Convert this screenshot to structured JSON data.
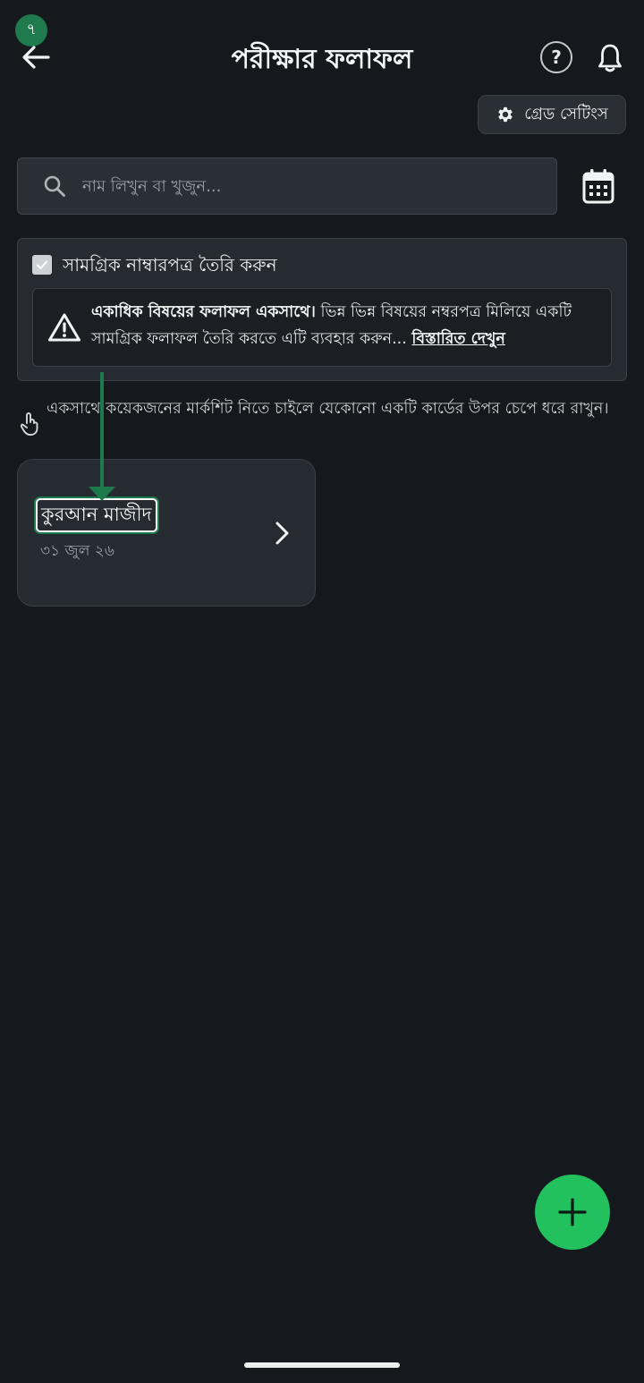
{
  "step_badge": "৭",
  "header": {
    "title": "পরীক্ষার ফলাফল",
    "help_label": "?",
    "grade_settings_label": "গ্রেড সেটিংস"
  },
  "search": {
    "placeholder": "নাম লিখুন বা খুজুন..."
  },
  "combined_marksheet": {
    "checkbox_label": "সামগ্রিক নাম্বারপত্র তৈরি করুন",
    "checked": true,
    "notice_bold": "একাধিক বিষয়ের ফলাফল একসাথে।",
    "notice_text": " ভিন্ন ভিন্ন বিষয়ের নম্বরপত্র মিলিয়ে একটি সামগ্রিক ফলাফল তৈরি করতে এটি ব্যবহার করুন... ",
    "notice_link": "বিস্তারিত দেখুন"
  },
  "hint": {
    "text": "একসাথে কয়েকজনের মার্কশিট নিতে চাইলে যেকোনো একটি কার্ডের উপর চেপে ধরে রাখুন।"
  },
  "subjects": [
    {
      "name": "কুরআন মাজীদ",
      "date": "৩১ জুল ২৬"
    }
  ],
  "colors": {
    "background": "#15181c",
    "card": "#262b31",
    "fab": "#22c15e",
    "highlight": "#1e7a4c"
  },
  "icons": {
    "back": "arrow-left-icon",
    "help": "question-circle-icon",
    "notifications": "bell-icon",
    "settings": "gear-icon",
    "search": "search-icon",
    "calendar": "calendar-icon",
    "warning": "warning-triangle-icon",
    "hint": "tap-hand-icon",
    "chevron": "chevron-right-icon",
    "add": "plus-icon"
  }
}
